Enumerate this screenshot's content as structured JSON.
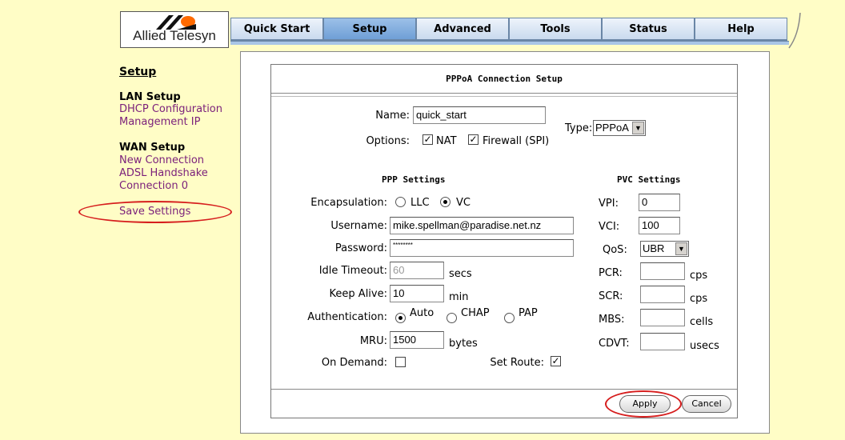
{
  "brand": {
    "logo_text": "Allied Telesyn"
  },
  "nav": {
    "tabs": [
      {
        "label": "Quick Start"
      },
      {
        "label": "Setup"
      },
      {
        "label": "Advanced"
      },
      {
        "label": "Tools"
      },
      {
        "label": "Status"
      },
      {
        "label": "Help"
      }
    ],
    "active": "Setup"
  },
  "sidebar": {
    "title": "Setup",
    "lan_head": "LAN Setup",
    "lan_items": [
      "DHCP Configuration",
      "Management IP"
    ],
    "wan_head": "WAN Setup",
    "wan_items": [
      "New Connection",
      "ADSL Handshake",
      "Connection 0"
    ],
    "save": "Save Settings"
  },
  "form": {
    "title": "PPPoA Connection Setup",
    "name_label": "Name:",
    "name_value": "quick_start",
    "type_label": "Type:",
    "type_value": "PPPoA",
    "options_label": "Options:",
    "opt_nat": "NAT",
    "opt_fw": "Firewall (SPI)",
    "ppp_head": "PPP Settings",
    "pvc_head": "PVC Settings",
    "encap_label": "Encapsulation:",
    "encap_llc": "LLC",
    "encap_vc": "VC",
    "user_label": "Username:",
    "user_value": "mike.spellman@paradise.net.nz",
    "pass_label": "Password:",
    "pass_value": "********",
    "idle_label": "Idle Timeout:",
    "idle_value": "60",
    "idle_unit": "secs",
    "keep_label": "Keep Alive:",
    "keep_value": "10",
    "keep_unit": "min",
    "auth_label": "Authentication:",
    "auth_auto": "Auto",
    "auth_chap": "CHAP",
    "auth_pap": "PAP",
    "mru_label": "MRU:",
    "mru_value": "1500",
    "mru_unit": "bytes",
    "ondemand_label": "On Demand:",
    "setroute_label": "Set Route:",
    "vpi_label": "VPI:",
    "vpi_value": "0",
    "vci_label": "VCI:",
    "vci_value": "100",
    "qos_label": "QoS:",
    "qos_value": "UBR",
    "pcr_label": "PCR:",
    "pcr_unit": "cps",
    "scr_label": "SCR:",
    "scr_unit": "cps",
    "mbs_label": "MBS:",
    "mbs_unit": "cells",
    "cdvt_label": "CDVT:",
    "cdvt_unit": "usecs",
    "apply": "Apply",
    "cancel": "Cancel"
  }
}
